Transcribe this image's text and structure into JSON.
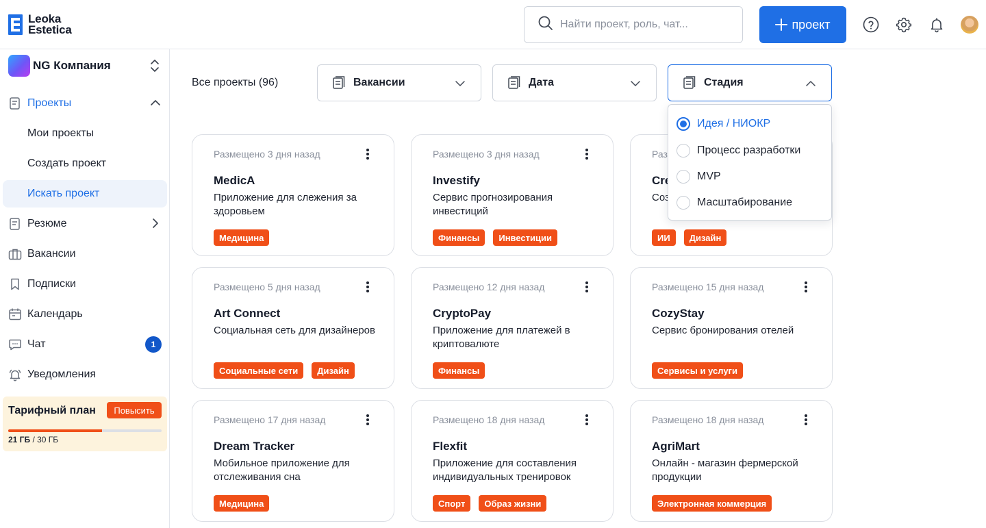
{
  "header": {
    "logo": {
      "line1": "Leoka",
      "line2": "Estetica"
    },
    "search_placeholder": "Найти проект, роль, чат...",
    "new_project_label": "проект",
    "icons": [
      "help-icon",
      "settings-gear-icon",
      "notification-bell-icon",
      "user-avatar"
    ]
  },
  "sidebar": {
    "company": "NG Компания",
    "items": [
      {
        "label": "Проекты",
        "icon": "projects-icon"
      },
      {
        "label": "Мои проекты"
      },
      {
        "label": "Создать проект"
      },
      {
        "label": "Искать проект"
      },
      {
        "label": "Резюме",
        "icon": "resume-icon"
      },
      {
        "label": "Вакансии",
        "icon": "briefcase-icon"
      },
      {
        "label": "Подписки",
        "icon": "bookmark-icon"
      },
      {
        "label": "Календарь",
        "icon": "calendar-icon"
      },
      {
        "label": "Чат",
        "icon": "chat-icon",
        "badge": "1"
      },
      {
        "label": "Уведомления",
        "icon": "bell-icon"
      }
    ],
    "plan": {
      "title": "Тарифный план",
      "upgrade_label": "Повысить",
      "used": "21 ГБ",
      "total": "/ 30 ГБ",
      "used_fraction": 0.61
    }
  },
  "filters": {
    "all_projects": "Все проекты (96)",
    "vacancies": "Вакансии",
    "date": "Дата",
    "stage": "Стадия",
    "stage_options": [
      "Идея / НИОКР",
      "Процесс разработки",
      "MVP",
      "Масштабирование"
    ],
    "stage_selected": "Идея / НИОКР"
  },
  "cards": [
    {
      "posted": "Размещено 3 дня назад",
      "title": "MedicA",
      "desc": "Приложение для слежения за здоровьем",
      "tags": [
        "Медицина"
      ]
    },
    {
      "posted": "Размещено 3 дня назад",
      "title": "Investify",
      "desc": "Сервис прогнозирования инвестиций",
      "tags": [
        "Финансы",
        "Инвестиции"
      ]
    },
    {
      "posted": "Раз",
      "title": "Cre",
      "desc": "Соз",
      "tags": [
        "ИИ",
        "Дизайн"
      ]
    },
    {
      "posted": "Размещено 5 дня назад",
      "title": "Art Connect",
      "desc": "Социальная сеть для дизайнеров",
      "tags": [
        "Социальные сети",
        "Дизайн"
      ]
    },
    {
      "posted": "Размещено 12 дня назад",
      "title": "CryptoPay",
      "desc": "Приложение для платежей в криптовалюте",
      "tags": [
        "Финансы"
      ]
    },
    {
      "posted": "Размещено 15 дня назад",
      "title": "CozyStay",
      "desc": "Сервис бронирования отелей",
      "tags": [
        "Сервисы и услуги"
      ]
    },
    {
      "posted": "Размещено 17 дня назад",
      "title": "Dream Tracker",
      "desc": "Мобильное приложение для отслеживания сна",
      "tags": [
        "Медицина"
      ]
    },
    {
      "posted": "Размещено 18 дня назад",
      "title": "Flexfit",
      "desc": "Приложение для составления индивидуальных тренировок",
      "tags": [
        "Спорт",
        "Образ жизни"
      ]
    },
    {
      "posted": "Размещено 18 дня назад",
      "title": "AgriMart",
      "desc": "Онлайн - магазин фермерской продукции",
      "tags": [
        "Электронная коммерция"
      ]
    }
  ],
  "colors": {
    "primary": "#1f6fe5",
    "tag": "#f04f18",
    "plan_bg": "#fdf3dd",
    "badge": "#1257c9"
  }
}
